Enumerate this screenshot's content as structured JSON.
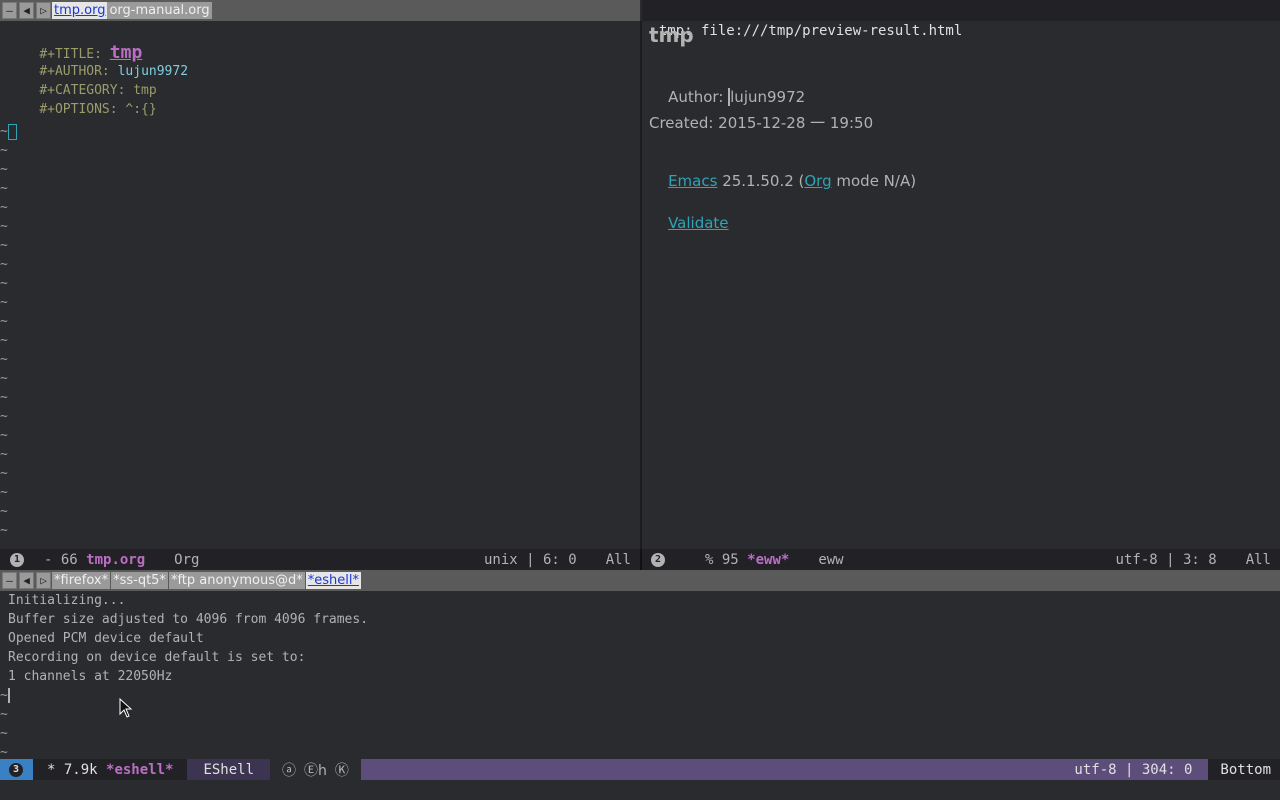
{
  "top_tabbar": {
    "tabs": [
      {
        "label": "tmp.org",
        "active": true
      },
      {
        "label": "org-manual.org",
        "active": false
      }
    ]
  },
  "left_buffer": {
    "lines": [
      {
        "keyword": "#+TITLE: ",
        "value": "tmp",
        "kind": "title"
      },
      {
        "keyword": "#+AUTHOR: ",
        "value": "lujun9972",
        "kind": "author"
      },
      {
        "keyword": "#+CATEGORY: ",
        "value": "tmp",
        "kind": "plain"
      },
      {
        "keyword": "#+OPTIONS: ",
        "value": "^:{}",
        "kind": "plain"
      }
    ],
    "tilde": "~"
  },
  "left_modeline": {
    "window_num": "1",
    "state": "- 66 ",
    "buffer": "tmp.org",
    "mode": "Org",
    "encoding": "unix | 6: 0",
    "position": "All"
  },
  "eww": {
    "header": "tmp: file:///tmp/preview-result.html",
    "title": "tmp",
    "author_label": "Author: ",
    "author": "lujun9972",
    "created": "Created: 2015-12-28 一 19:50",
    "emacs_link": "Emacs",
    "version_text": " 25.1.50.2 (",
    "org_link": "Org",
    "mode_text": " mode N/A)",
    "validate_link": "Validate"
  },
  "right_modeline": {
    "window_num": "2",
    "state": "% 95 ",
    "buffer": "*eww*",
    "mode": "eww",
    "encoding": "utf-8 | 3: 8",
    "position": "All"
  },
  "bottom_tabbar": {
    "tabs": [
      {
        "label": "*firefox*",
        "active": false
      },
      {
        "label": "*ss-qt5*",
        "active": false
      },
      {
        "label": "*ftp anonymous@d*",
        "active": false
      },
      {
        "label": "*eshell*",
        "active": true
      }
    ]
  },
  "eshell": {
    "lines": [
      "Initializing...",
      "Buffer size adjusted to 4096 from 4096 frames.",
      "Opened PCM device default",
      "Recording on device default is set to:",
      "1 channels at 22050Hz"
    ]
  },
  "bottom_modeline": {
    "window_num": "3",
    "state": "* 7.9k ",
    "buffer": "*eshell*",
    "mode": "EShell",
    "minor_modes": [
      "ⓐ",
      "Ⓔh",
      "Ⓚ"
    ],
    "encoding": "utf-8 | 304: 0",
    "position": "Bottom"
  },
  "colors": {
    "background": "#292b2e",
    "modeline": "#222226",
    "accent": "#bc6ec5",
    "link": "#2fa4b7"
  }
}
